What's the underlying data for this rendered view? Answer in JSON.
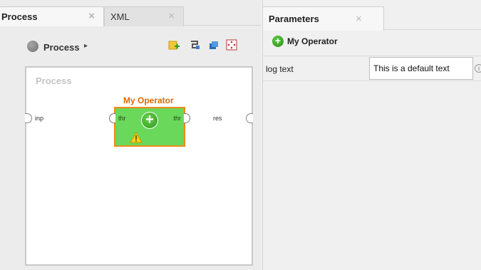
{
  "left_panel": {
    "tabs": [
      {
        "label": "Process",
        "close": "×"
      },
      {
        "label": "XML",
        "close": "×"
      }
    ],
    "breadcrumb": {
      "label": "Process",
      "arrow": "▸"
    },
    "toolbar_icons": [
      "add-operator-icon",
      "auto-wire-icon",
      "layers-icon",
      "arrange-icon"
    ],
    "canvas": {
      "title": "Process",
      "left_port_label": "inp",
      "right_port_label": "res",
      "operator": {
        "name": "My Operator",
        "in_port": "thr",
        "out_port": "thr",
        "icon": "plus-icon",
        "warning": "warning-icon"
      }
    }
  },
  "right_panel": {
    "tab": {
      "label": "Parameters",
      "close": "×"
    },
    "operator_title": "My Operator",
    "parameter": {
      "label": "log text",
      "value": "This is a default text"
    }
  },
  "colors": {
    "operator_fill": "#6ad85a",
    "operator_border": "#ef8a1a",
    "operator_title": "#e06a00"
  }
}
